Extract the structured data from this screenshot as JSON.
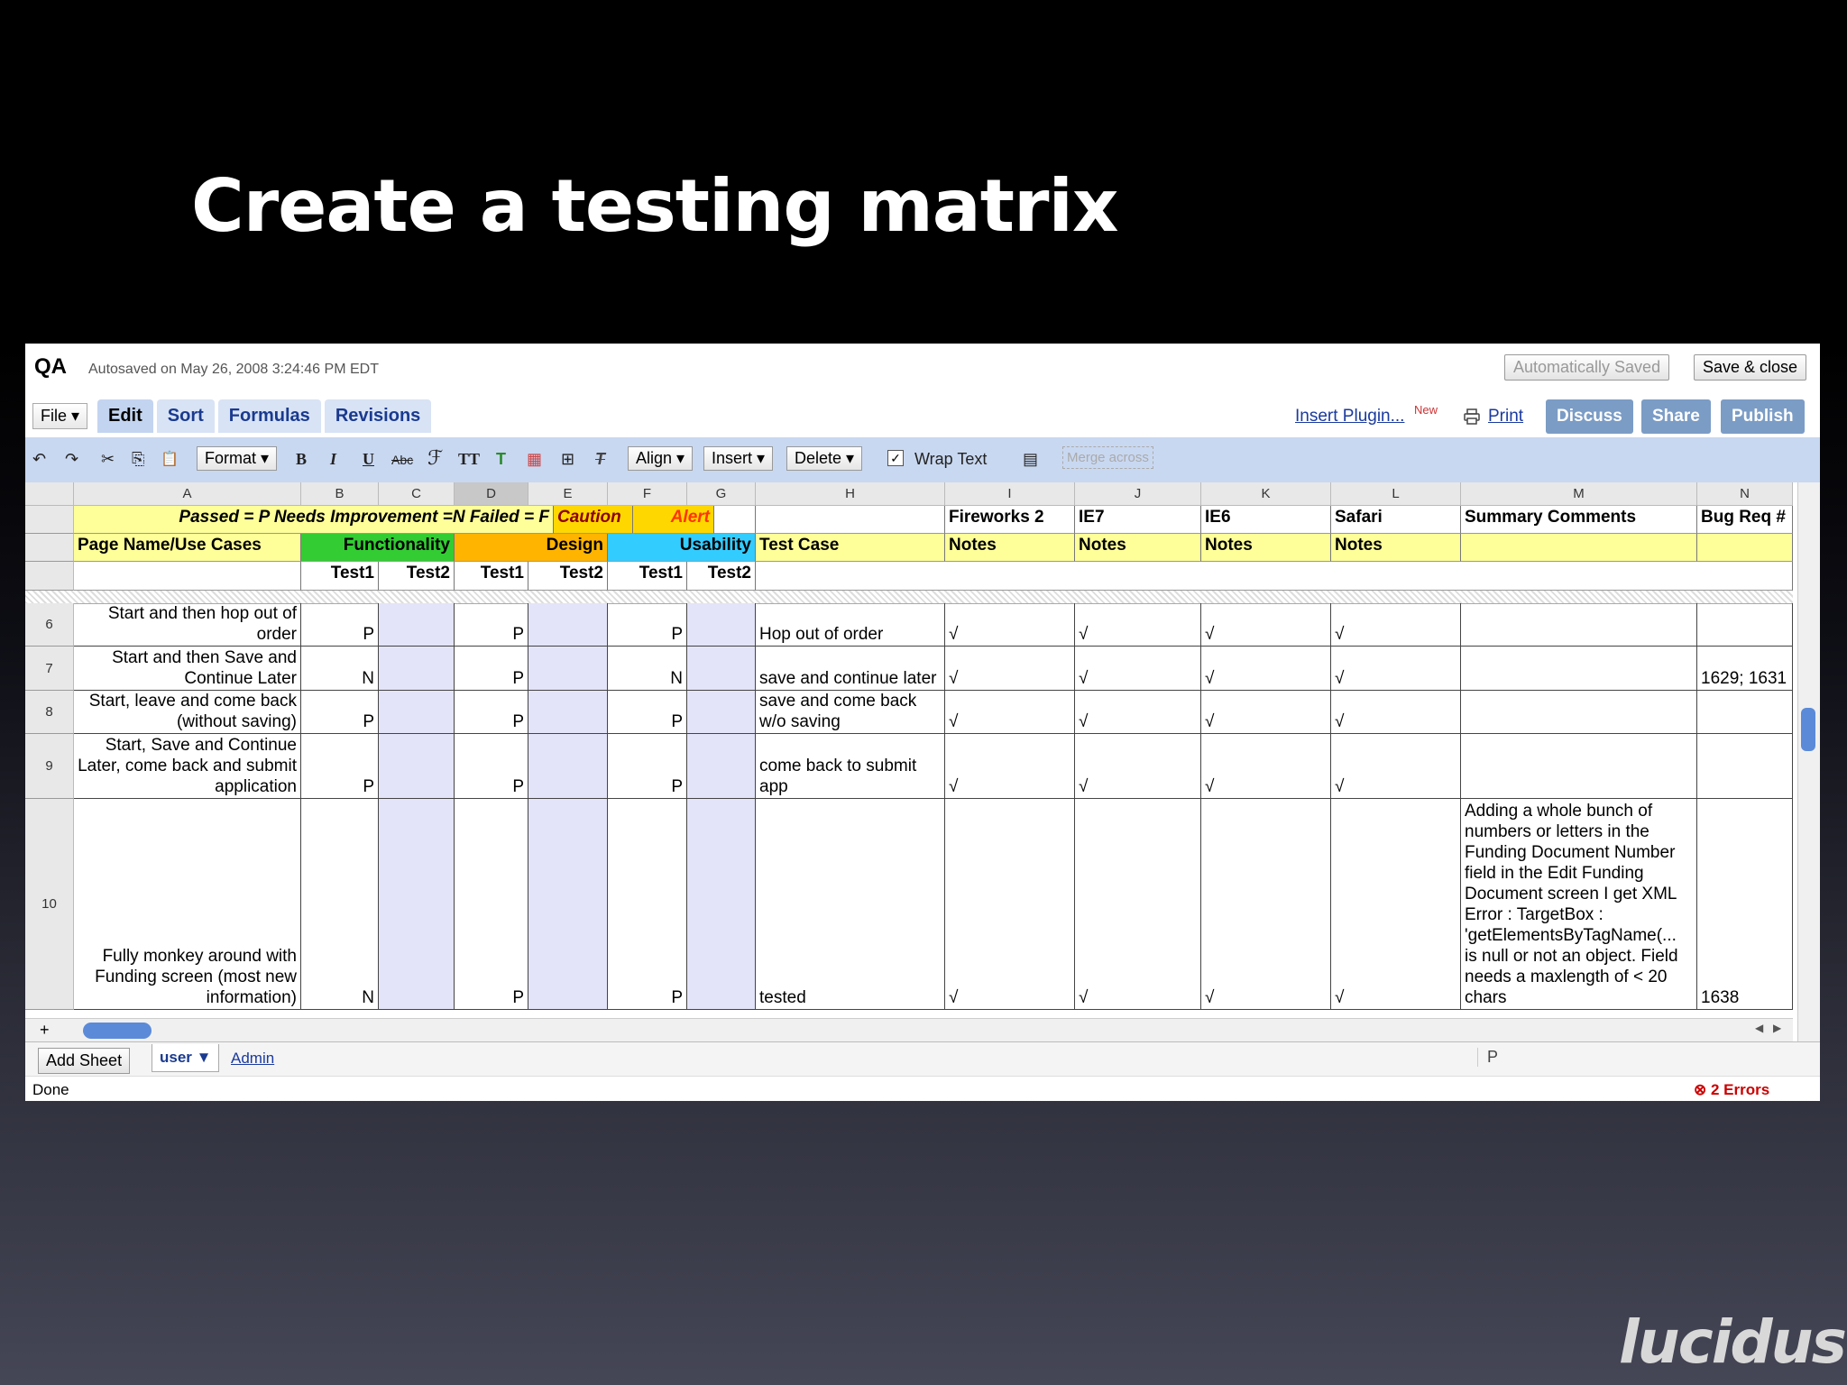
{
  "slide": {
    "title": "Create a testing matrix",
    "logo": "lucidus"
  },
  "app": {
    "doc_title": "QA",
    "autosave": "Autosaved on May 26, 2008 3:24:46 PM EDT",
    "auto_saved_label": "Automatically Saved",
    "save_close_label": "Save & close",
    "file_menu": "File",
    "tabs": [
      "Edit",
      "Sort",
      "Formulas",
      "Revisions"
    ],
    "insert_plugin": "Insert Plugin...",
    "new_badge": "New",
    "print": "Print",
    "discuss": "Discuss",
    "share": "Share",
    "publish": "Publish"
  },
  "toolbar": {
    "format": "Format",
    "align": "Align",
    "insert": "Insert",
    "delete": "Delete",
    "wrap_text": "Wrap Text",
    "wrap_checked": "✓",
    "merge_across": "Merge across",
    "undo_icon": "↶",
    "redo_icon": "↷",
    "cut_icon": "✂",
    "copy_icon": "⎘",
    "paste_icon": "📋",
    "bold": "B",
    "italic": "I",
    "underline": "U",
    "strike": "Abc",
    "font_icon": "ℱ",
    "size_icon": "TT",
    "text_color_icon": "T",
    "bg_color_icon": "▦",
    "borders_icon": "⊞",
    "clear_icon": "T",
    "chart_icon": "▤"
  },
  "columns": [
    "A",
    "B",
    "C",
    "D",
    "E",
    "F",
    "G",
    "H",
    "I",
    "J",
    "K",
    "L",
    "M",
    "N"
  ],
  "header_rows": {
    "legend_left": "Passed = P Needs Improvement =N Failed = F",
    "caution": "Caution",
    "alert": "Alert",
    "fireworks": "Fireworks 2",
    "ie7": "IE7",
    "ie6": "IE6",
    "safari": "Safari",
    "summary_comments": "Summary Comments",
    "bug_req": "Bug Req #",
    "page_name": "Page Name/Use Cases",
    "functionality": "Functionality",
    "design": "Design",
    "usability": "Usability",
    "test_case": "Test Case",
    "notes": "Notes",
    "test1": "Test1",
    "test2": "Test2"
  },
  "rows": [
    {
      "num": "6",
      "a": "Start and then hop out of order",
      "b": "P",
      "d": "P",
      "f": "P",
      "h": "Hop out of order",
      "i": "√",
      "j": "√",
      "k": "√",
      "l": "√",
      "m": "",
      "n": ""
    },
    {
      "num": "7",
      "a": "Start and then Save and Continue Later",
      "b": "N",
      "d": "P",
      "f": "N",
      "h": "save and continue later",
      "i": "√",
      "j": "√",
      "k": "√",
      "l": "√",
      "m": "",
      "n": "1629; 1631"
    },
    {
      "num": "8",
      "a": "Start, leave and come back (without saving)",
      "b": "P",
      "d": "P",
      "f": "P",
      "h": "save and come back w/o saving",
      "i": "√",
      "j": "√",
      "k": "√",
      "l": "√",
      "m": "",
      "n": ""
    },
    {
      "num": "9",
      "a": "Start, Save and Continue Later, come back and submit application",
      "b": "P",
      "d": "P",
      "f": "P",
      "h": "come back to submit app",
      "i": "√",
      "j": "√",
      "k": "√",
      "l": "√",
      "m": "",
      "n": ""
    },
    {
      "num": "10",
      "a": "Fully monkey around with Funding screen (most new information)",
      "b": "N",
      "d": "P",
      "f": "P",
      "h": "tested",
      "i": "√",
      "j": "√",
      "k": "√",
      "l": "√",
      "m": "Adding a whole bunch of numbers or letters in the Funding Document Number field in the Edit Funding Document screen I get XML Error : TargetBox : 'getElementsByTagName(... is null or not an object. Field needs a maxlength of < 20 chars",
      "n": "1638"
    }
  ],
  "bottom": {
    "add_sheet": "Add Sheet",
    "sheet_tab": "user",
    "admin": "Admin",
    "formula_value": "P",
    "status": "Done",
    "errors": "2 Errors",
    "plus": "+"
  },
  "colors": {
    "yellow": "#ffff99",
    "green": "#33cc33",
    "orange": "#ffb400",
    "cyan": "#33ccff",
    "caution": "#ffd700",
    "lavender": "#e3e3f9",
    "accent_blue": "#7b9cc5"
  }
}
